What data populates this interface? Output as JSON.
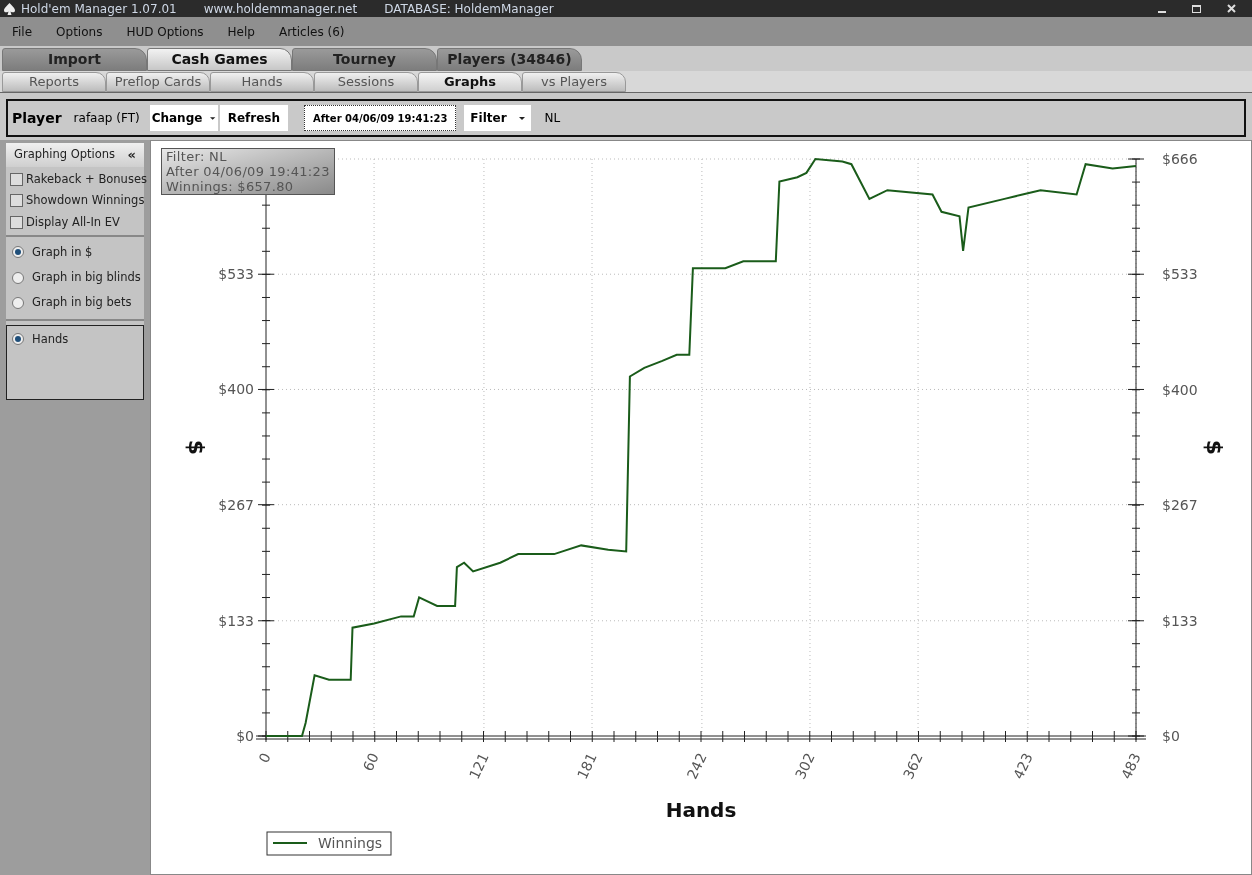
{
  "window": {
    "title": "Hold'em Manager 1.07.01",
    "website": "www.holdemmanager.net",
    "database": "DATABASE: HoldemManager"
  },
  "menu": [
    "File",
    "Options",
    "HUD Options",
    "Help",
    "Articles (6)"
  ],
  "main_tabs": [
    {
      "label": "Import",
      "selected": false
    },
    {
      "label": "Cash Games",
      "selected": true
    },
    {
      "label": "Tourney",
      "selected": false
    },
    {
      "label": "Players (34846)",
      "selected": false
    }
  ],
  "sub_tabs": [
    {
      "label": "Reports",
      "selected": false
    },
    {
      "label": "Preflop Cards",
      "selected": false
    },
    {
      "label": "Hands",
      "selected": false
    },
    {
      "label": "Sessions",
      "selected": false
    },
    {
      "label": "Graphs",
      "selected": true
    },
    {
      "label": "vs Players",
      "selected": false
    }
  ],
  "toolbar": {
    "player_label": "Player",
    "player": "rafaap (FT)",
    "change": "Change",
    "refresh": "Refresh",
    "date": "After 04/06/09 19:41:23",
    "filter": "Filter",
    "filter_value": "NL"
  },
  "graphing_options": {
    "title": "Graphing Options",
    "collapse": "«",
    "checkboxes": [
      {
        "label": "Rakeback + Bonuses",
        "checked": false
      },
      {
        "label": "Showdown Winnings",
        "checked": false
      },
      {
        "label": "Display All-In EV",
        "checked": false
      }
    ],
    "units": [
      {
        "label": "Graph in $",
        "selected": true
      },
      {
        "label": "Graph in big blinds",
        "selected": false
      },
      {
        "label": "Graph in big bets",
        "selected": false
      }
    ],
    "x_axis": [
      {
        "label": "Hands",
        "selected": true
      }
    ]
  },
  "graph": {
    "tooltip": [
      "Filter: NL",
      "After 04/06/09 19:41:23",
      "Winnings: $657.80"
    ],
    "right_axis": {
      "label": "$",
      "ticks": [
        "$666",
        "$533",
        "$400",
        "$267",
        "$133",
        "$0"
      ]
    },
    "chart_data": {
      "type": "line",
      "grid": true,
      "xlabel": "Hands",
      "ylabel": "$",
      "x": [
        0,
        20,
        22,
        27,
        35,
        47,
        48,
        60,
        75,
        82,
        85,
        95,
        105,
        106,
        110,
        115,
        130,
        140,
        160,
        175,
        190,
        200,
        202,
        210,
        220,
        228,
        235,
        237,
        255,
        265,
        283,
        285,
        295,
        300,
        305,
        320,
        325,
        335,
        345,
        370,
        375,
        385,
        387,
        390,
        410,
        420,
        430,
        450,
        455,
        470,
        483
      ],
      "series": [
        {
          "name": "Winnings",
          "color": "#1a5c1a",
          "values": [
            0,
            0,
            15,
            70,
            65,
            65,
            125,
            130,
            138,
            138,
            160,
            150,
            150,
            195,
            200,
            190,
            200,
            210,
            210,
            220,
            215,
            213,
            415,
            425,
            433,
            440,
            440,
            540,
            540,
            548,
            548,
            640,
            645,
            650,
            666,
            663,
            660,
            620,
            630,
            625,
            605,
            600,
            560,
            610,
            620,
            625,
            630,
            625,
            660,
            655,
            658
          ]
        }
      ],
      "xlim": [
        0,
        483
      ],
      "ylim": [
        0,
        666
      ],
      "xticks": [
        0,
        60,
        121,
        181,
        242,
        302,
        362,
        423,
        483
      ],
      "yticks": [
        {
          "value": 0,
          "label": "$0"
        },
        {
          "value": 133,
          "label": "$133"
        },
        {
          "value": 267,
          "label": "$267"
        },
        {
          "value": 400,
          "label": "$400"
        },
        {
          "value": 533,
          "label": "$533"
        }
      ]
    }
  }
}
